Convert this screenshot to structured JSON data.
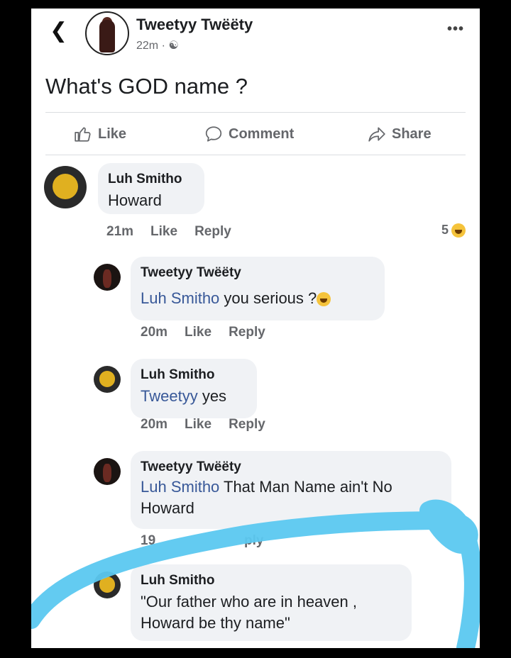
{
  "header": {
    "back_icon": "chevron-left-icon",
    "poster_name": "Tweetyy Twëëty",
    "time": "22m · ",
    "audience_icon": "friends-icon",
    "more_icon": "more-horizontal-icon",
    "more_glyph": "•••"
  },
  "post": {
    "text": "What's GOD name ?"
  },
  "actions": {
    "like": "Like",
    "comment": "Comment",
    "share": "Share"
  },
  "comments": [
    {
      "author": "Luh Smitho",
      "text": "Howard",
      "time": "21m",
      "like": "Like",
      "reply": "Reply",
      "reaction_count": "5",
      "reaction_icon": "haha-emoji-icon"
    },
    {
      "author": "Tweetyy Twëëty",
      "mention": "Luh Smitho",
      "text": " you serious ?",
      "time": "20m",
      "like": "Like",
      "reply": "Reply"
    },
    {
      "author": "Luh Smitho",
      "mention": "Tweetyy",
      "text": " yes",
      "time": "20m",
      "like": "Like",
      "reply": "Reply"
    },
    {
      "author": "Tweetyy Twëëty",
      "mention": "Luh Smitho",
      "text_line1": " That Man Name ain't No",
      "text_line2": "Howard",
      "time": "19",
      "reply": "ply"
    },
    {
      "author": "Luh Smitho",
      "text_line1": "\"Our father who are in heaven ,",
      "text_line2": "Howard be thy name\""
    }
  ],
  "colors": {
    "mention": "#385898",
    "highlight": "#5bc8f0",
    "bubble": "#f0f2f5"
  }
}
